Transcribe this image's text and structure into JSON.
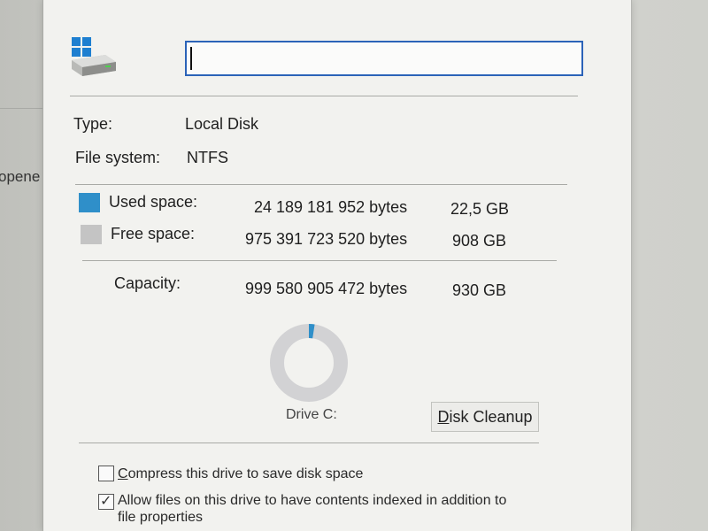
{
  "background": {
    "partial_text": "opene"
  },
  "dialog": {
    "drive_name_value": "",
    "type_label": "Type:",
    "type_value": "Local Disk",
    "filesystem_label": "File system:",
    "filesystem_value": "NTFS",
    "used": {
      "label": "Used space:",
      "bytes": "24 189 181 952 bytes",
      "size": "22,5 GB",
      "color": "#2f8fc9"
    },
    "free": {
      "label": "Free space:",
      "bytes": "975 391 723 520 bytes",
      "size": "908 GB",
      "color": "#c4c4c4"
    },
    "capacity": {
      "label": "Capacity:",
      "bytes": "999 580 905 472 bytes",
      "size": "930 GB"
    },
    "used_fraction": 0.024,
    "drive_label": "Drive C:",
    "cleanup_button": {
      "underlined": "D",
      "rest": "isk Cleanup"
    },
    "compress_option": {
      "underlined": "C",
      "rest": "ompress this drive to save disk space",
      "checked": false
    },
    "index_option": {
      "line1": "Allow files on this drive to have contents indexed in addition to",
      "line2": "file properties",
      "checked": true
    }
  }
}
